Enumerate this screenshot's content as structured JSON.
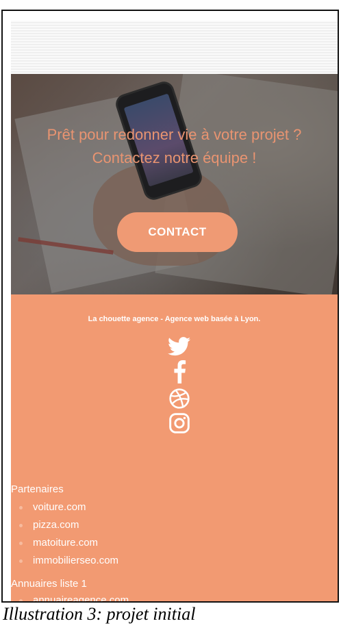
{
  "hero": {
    "title_line1": "Prêt pour redonner vie à votre projet ?",
    "title_line2": "Contactez notre équipe !",
    "contact_label": "CONTACT"
  },
  "footer": {
    "tagline": "La chouette agence - Agence web basée à Lyon.",
    "socials": [
      "twitter-icon",
      "facebook-icon",
      "dribbble-icon",
      "instagram-icon"
    ],
    "partners_title": "Partenaires",
    "partners": [
      "voiture.com",
      "pizza.com",
      "matoiture.com",
      "immobilierseo.com"
    ],
    "annuaires_title": "Annuaires liste 1",
    "annuaires": [
      "annuaireagence.com"
    ]
  },
  "caption": "Illustration 3: projet initial",
  "colors": {
    "accent": "#f29a72",
    "button": "#ef9a74",
    "hero_text": "#e99471"
  }
}
